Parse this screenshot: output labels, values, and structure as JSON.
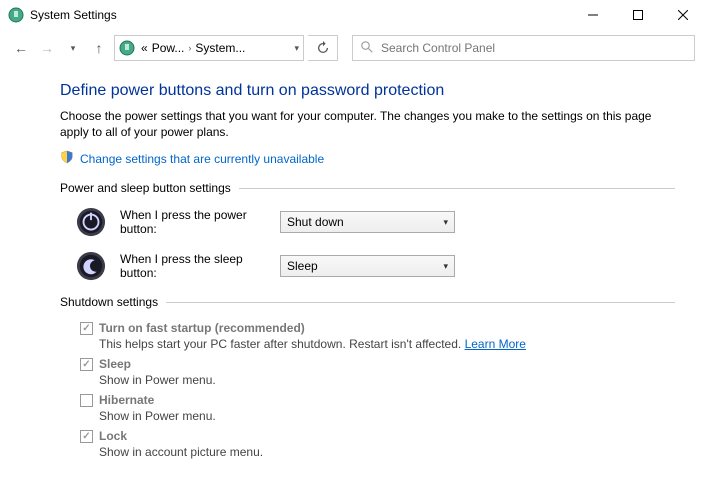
{
  "window": {
    "title": "System Settings"
  },
  "toolbar": {
    "crumb1": "Pow...",
    "crumb2": "System...",
    "search_placeholder": "Search Control Panel"
  },
  "page": {
    "heading": "Define power buttons and turn on password protection",
    "description": "Choose the power settings that you want for your computer. The changes you make to the settings on this page apply to all of your power plans.",
    "change_link": "Change settings that are currently unavailable"
  },
  "sections": {
    "buttons_label": "Power and sleep button settings",
    "shutdown_label": "Shutdown settings"
  },
  "settings": {
    "power_label": "When I press the power button:",
    "power_value": "Shut down",
    "sleep_label": "When I press the sleep button:",
    "sleep_value": "Sleep"
  },
  "shutdown": {
    "fast": {
      "label": "Turn on fast startup (recommended)",
      "desc_prefix": "This helps start your PC faster after shutdown. Restart isn't affected. ",
      "learn_more": "Learn More"
    },
    "sleep": {
      "label": "Sleep",
      "desc": "Show in Power menu."
    },
    "hibernate": {
      "label": "Hibernate",
      "desc": "Show in Power menu."
    },
    "lock": {
      "label": "Lock",
      "desc": "Show in account picture menu."
    }
  }
}
